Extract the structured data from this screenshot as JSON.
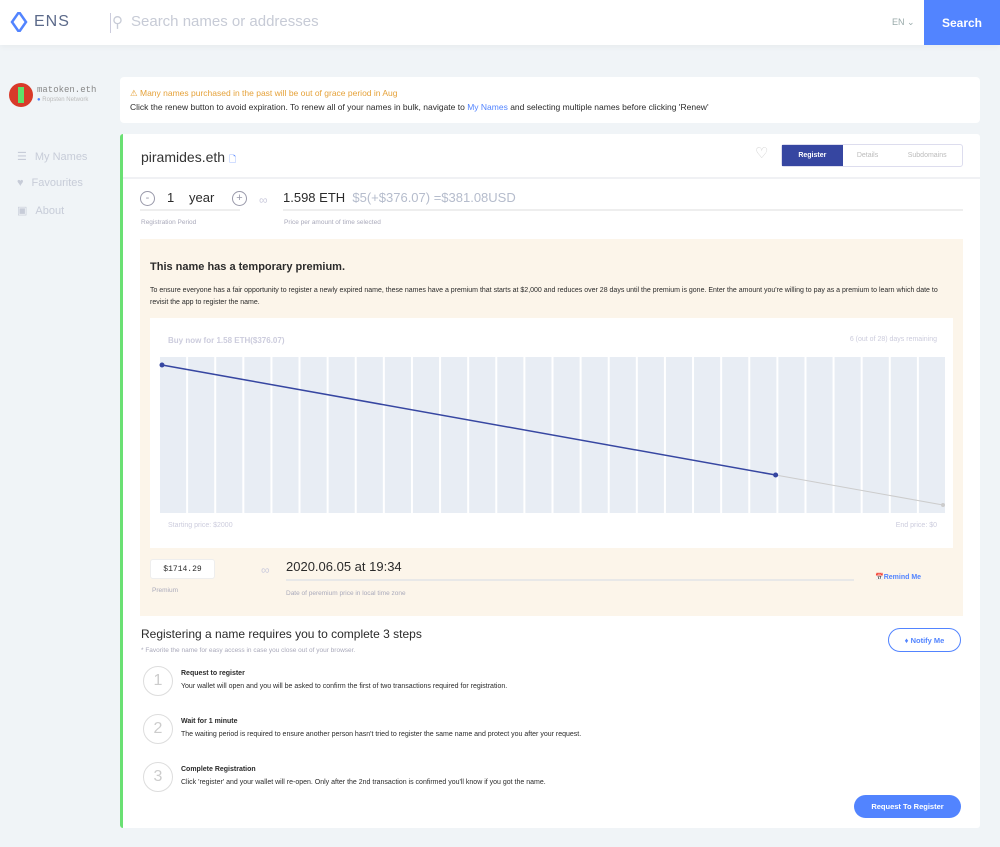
{
  "header": {
    "logo": "ENS",
    "search_placeholder": "Search names or addresses",
    "lang": "EN",
    "search_label": "Search"
  },
  "sidebar": {
    "account": "matoken.eth",
    "network": "Ropsten Network",
    "items": [
      {
        "label": "My Names"
      },
      {
        "label": "Favourites"
      },
      {
        "label": "About"
      }
    ]
  },
  "notice": {
    "title": "Many names purchased in the past will be out of grace period in Aug",
    "text_before": "Click the renew button to avoid expiration. To renew all of your names in bulk, navigate to ",
    "link": "My Names",
    "text_after": " and selecting multiple names before clicking 'Renew'"
  },
  "name": {
    "title": "piramides.eth",
    "tabs": [
      "Register",
      "Details",
      "Subdomains"
    ]
  },
  "period": {
    "minus": "-",
    "plus": "+",
    "value": "1",
    "unit": "year",
    "label": "Registration Period",
    "eth": "1.598 ETH",
    "usd": "$5(+$376.07) =$381.08USD",
    "price_label": "Price per amount of time selected"
  },
  "premium": {
    "title": "This name has a temporary premium.",
    "desc": "To ensure everyone has a fair opportunity to register a newly expired name, these names have a premium that starts at $2,000 and reduces over 28 days until the premium is gone. Enter the amount you're willing to pay as a premium to learn which date to revisit the app to register the name.",
    "buy_now": "Buy now for 1.58 ETH($376.07)",
    "remaining": "6 (out of 28) days remaining",
    "start_label": "Starting price: $2000",
    "end_label": "End price: $0",
    "amount": "$1714.29",
    "amount_label": "Premium",
    "date": "2020.06.05 at 19:34",
    "date_label": "Date of peremium price in local time zone",
    "remind": "Remind Me"
  },
  "chart_data": {
    "type": "line",
    "total_days": 28,
    "elapsed_days": 22,
    "start_price": 2000,
    "end_price": 0,
    "current_premium": 376.07,
    "ylim": [
      0,
      2000
    ],
    "xlim": [
      0,
      28
    ]
  },
  "steps": {
    "title": "Registering a name requires you to complete 3 steps",
    "note": "* Favorite the name for easy access in case you close out of your browser.",
    "notify": "Notify Me",
    "items": [
      {
        "n": "1",
        "title": "Request to register",
        "desc": "Your wallet will open and you will be asked to confirm the first of two transactions required for registration."
      },
      {
        "n": "2",
        "title": "Wait for 1 minute",
        "desc": "The waiting period is required to ensure another person hasn't tried to register the same name and protect you after your request."
      },
      {
        "n": "3",
        "title": "Complete Registration",
        "desc": "Click 'register' and your wallet will re-open. Only after the 2nd transaction is confirmed you'll know if you got the name."
      }
    ],
    "action": "Request To Register"
  },
  "colors": {
    "accent": "#5284ff",
    "tab": "#3646a1",
    "warn": "#e5a23a",
    "line": "#3646a1"
  }
}
